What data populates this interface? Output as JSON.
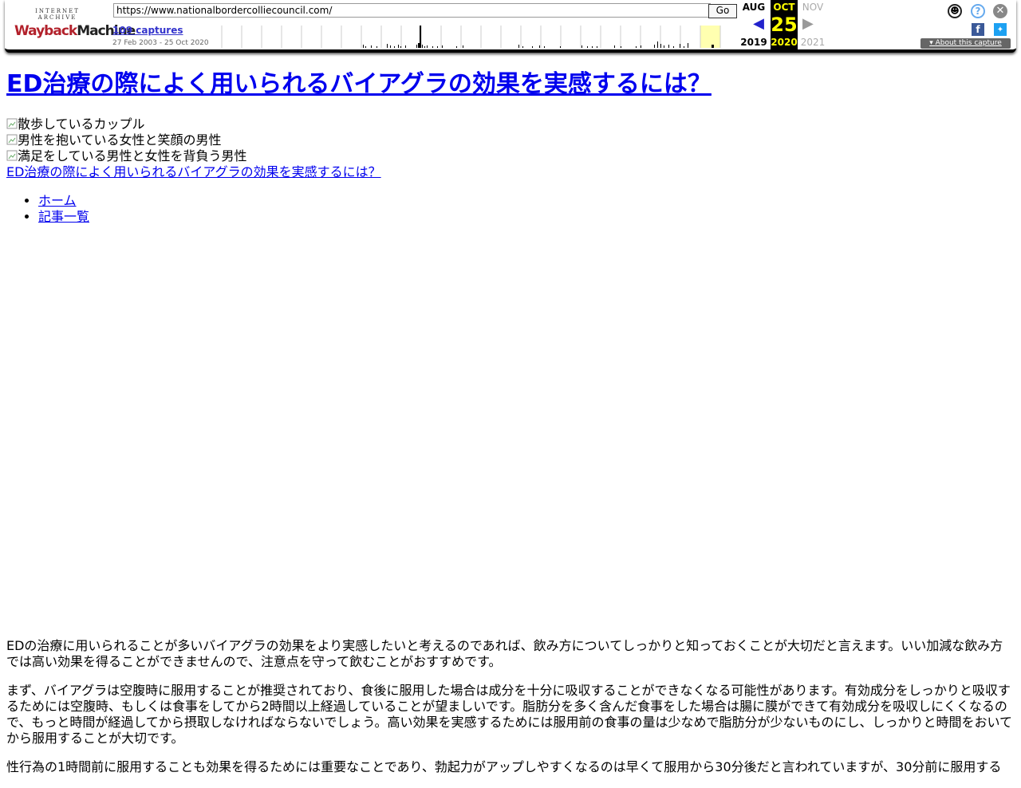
{
  "toolbar": {
    "logo_top": "INTERNET ARCHIVE",
    "logo_wayback": "Wayback",
    "logo_machine": "Machine",
    "url": "https://www.nationalbordercolliecouncil.com/",
    "go_label": "Go",
    "captures": "109 captures",
    "date_range": "27 Feb 2003 - 25 Oct 2020",
    "prev_month": "AUG",
    "prev_year": "2019",
    "cur_month": "OCT",
    "cur_day": "25",
    "cur_year": "2020",
    "next_month": "NOV",
    "next_year": "2021",
    "about": "About this capture",
    "icons": [
      "user-icon",
      "help-icon",
      "close-icon",
      "facebook-icon",
      "twitter-icon"
    ]
  },
  "article": {
    "title": "ED治療の際によく用いられるバイアグラの効果を実感するには？",
    "image_alts": [
      "散歩しているカップル",
      "男性を抱いている女性と笑顔の男性",
      "満足をしている男性と女性を背負う男性"
    ],
    "breadcrumb_link": "ED治療の際によく用いられるバイアグラの効果を実感するには？",
    "nav": [
      "ホーム",
      "記事一覧"
    ],
    "paragraphs": [
      "EDの治療に用いられることが多いバイアグラの効果をより実感したいと考えるのであれば、飲み方についてしっかりと知っておくことが大切だと言えます。いい加減な飲み方では高い効果を得ることができませんので、注意点を守って飲むことがおすすめです。",
      "まず、バイアグラは空腹時に服用することが推奨されており、食後に服用した場合は成分を十分に吸収することができなくなる可能性があります。有効成分をしっかりと吸収するためには空腹時、もしくは食事をしてから2時間以上経過していることが望ましいです。脂肪分を多く含んだ食事をした場合は腸に膜ができて有効成分を吸収しにくくなるので、もっと時間が経過してから摂取しなければならないでしょう。高い効果を実感するためには服用前の食事の量は少なめで脂肪分が少ないものにし、しっかりと時間をおいてから服用することが大切です。",
      "性行為の1時間前に服用することも効果を得るためには重要なことであり、勃起力がアップしやすくなるのは早くて服用から30分後だと言われていますが、30分前に服用する"
    ]
  }
}
